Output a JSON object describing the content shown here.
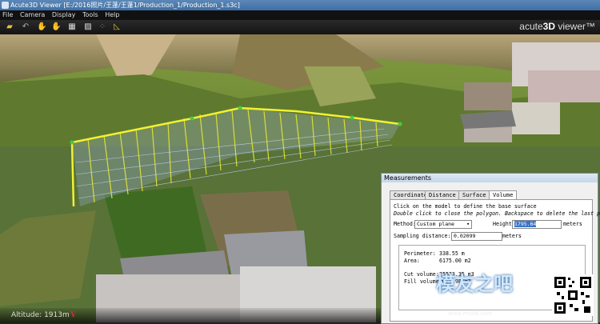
{
  "window": {
    "title": "Acute3D Viewer [E:/2016照片/王蓬/王蓬1/Production_1/Production_1.s3c]"
  },
  "menu": [
    "File",
    "Camera",
    "Display",
    "Tools",
    "Help"
  ],
  "toolbar": {
    "brand_prefix": "acute",
    "brand_mid": "3D",
    "brand_suffix": " viewer™"
  },
  "toolbar_icons": [
    "open-folder-icon",
    "undo-icon",
    "pan-hand-icon",
    "hand-icon",
    "checker-icon",
    "image-icon",
    "dots-icon",
    "measure-icon"
  ],
  "status": {
    "altitude": "Altitude: 1913m",
    "v_mark": "V"
  },
  "measurements": {
    "title": "Measurements",
    "tabs": [
      "Coordinate",
      "Distance",
      "Surface",
      "Volume"
    ],
    "active_tab": "Volume",
    "instructions1": "Click on the model to define the base surface",
    "instructions2": "Double click to close the polygon. Backspace to delete the last point",
    "method_label": "Method:",
    "method_value": "Custom plane",
    "height_label": "Height:",
    "height_value": "1795.64",
    "height_unit": "meters",
    "sampling_label": "Sampling distance:",
    "sampling_value": "0.02099",
    "sampling_unit": "meters",
    "perimeter_label": "Perimeter:",
    "perimeter_value": "338.55 m",
    "area_label": "Area:",
    "area_value": "6175.00 m2",
    "cut_label": "Cut volume:",
    "cut_value": "25523.35 m3",
    "fill_label": "Fill volume:",
    "fill_value": "2616.98 m3"
  },
  "watermark": {
    "text": "模友之吧",
    "url": "www.moz8.com"
  }
}
